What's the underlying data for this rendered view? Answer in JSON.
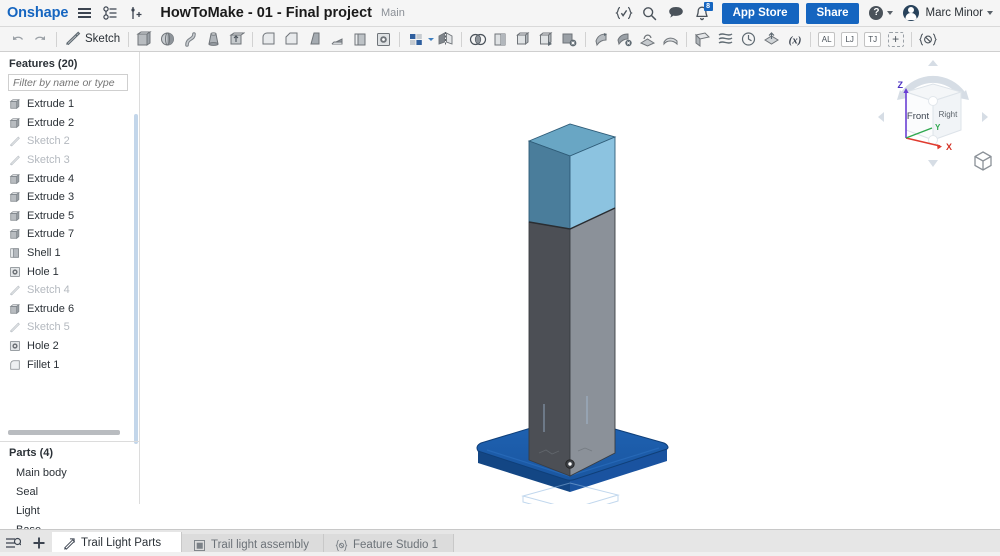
{
  "app": {
    "brand": "Onshape",
    "document_title": "HowToMake - 01 - Final project",
    "branch": "Main"
  },
  "topbar": {
    "icons": [
      {
        "name": "hamburger-menu-icon",
        "glyph": "menu"
      },
      {
        "name": "version-graph-icon",
        "glyph": "branch"
      },
      {
        "name": "insert-version-icon",
        "glyph": "addnode"
      }
    ],
    "right_icons": [
      {
        "name": "featurescript-icon",
        "label": "{v}"
      },
      {
        "name": "search-icon",
        "label": "search"
      },
      {
        "name": "comment-icon",
        "label": "comment"
      },
      {
        "name": "notifications-icon",
        "label": "bell",
        "badge": "8"
      }
    ],
    "app_store_label": "App Store",
    "share_label": "Share",
    "help_label": "?",
    "user_name": "Marc Minor"
  },
  "toolbar": {
    "undo_label": "undo",
    "redo_label": "redo",
    "sketch_label": "Sketch",
    "tools": [
      "extrude-tool",
      "revolve-tool",
      "sweep-tool",
      "loft-tool",
      "thicken-tool",
      "fillet-tool",
      "chamfer-tool",
      "draft-tool",
      "rib-tool",
      "shell-tool",
      "hole-tool",
      "pattern-tool",
      "mirror-tool",
      "boolean-tool",
      "split-tool",
      "transform-tool",
      "move-face-tool",
      "delete-face-tool",
      "replace-face-tool",
      "enclose-tool",
      "plane-tool",
      "sketch-plane-tool",
      "curve-tool",
      "helix-tool",
      "import-derived-tool",
      "variable-tool"
    ],
    "annotation_buttons": [
      "AL",
      "LJ",
      "TJ"
    ],
    "add_custom_label": "+",
    "configuration_label": "{⊘}"
  },
  "features_panel": {
    "title": "Features (20)",
    "filter_placeholder": "Filter by name or type",
    "items": [
      {
        "label": "Extrude 1",
        "icon": "extrude-icon",
        "dim": false
      },
      {
        "label": "Extrude 2",
        "icon": "extrude-icon",
        "dim": false
      },
      {
        "label": "Sketch 2",
        "icon": "sketch-icon",
        "dim": true
      },
      {
        "label": "Sketch 3",
        "icon": "sketch-icon",
        "dim": true
      },
      {
        "label": "Extrude 4",
        "icon": "extrude-icon",
        "dim": false
      },
      {
        "label": "Extrude 3",
        "icon": "extrude-icon",
        "dim": false
      },
      {
        "label": "Extrude 5",
        "icon": "extrude-icon",
        "dim": false
      },
      {
        "label": "Extrude 7",
        "icon": "extrude-icon",
        "dim": false
      },
      {
        "label": "Shell 1",
        "icon": "shell-icon",
        "dim": false
      },
      {
        "label": "Hole 1",
        "icon": "hole-icon",
        "dim": false
      },
      {
        "label": "Sketch 4",
        "icon": "sketch-icon",
        "dim": true
      },
      {
        "label": "Extrude 6",
        "icon": "extrude-icon",
        "dim": false
      },
      {
        "label": "Sketch 5",
        "icon": "sketch-icon",
        "dim": true
      },
      {
        "label": "Hole 2",
        "icon": "hole-icon",
        "dim": false
      },
      {
        "label": "Fillet 1",
        "icon": "fillet-icon",
        "dim": false
      }
    ]
  },
  "parts_panel": {
    "title": "Parts (4)",
    "items": [
      {
        "label": "Main body"
      },
      {
        "label": "Seal"
      },
      {
        "label": "Light"
      },
      {
        "label": "Base"
      }
    ]
  },
  "viewport": {
    "navcube": {
      "front_label": "Front",
      "right_label": "Right",
      "axis_x": "X",
      "axis_y": "Y",
      "axis_z": "Z"
    },
    "model_colors": {
      "light_front": "#4a7d9b",
      "light_right": "#8cc3e0",
      "light_top": "#69a6c4",
      "body_front": "#4c4f55",
      "body_right": "#8b9199",
      "base_top": "#1c5ba8",
      "base_edge": "#134684"
    }
  },
  "tabbar": {
    "tools": [
      {
        "name": "tab-manager-icon"
      },
      {
        "name": "add-tab-icon",
        "label": "+"
      }
    ],
    "tabs": [
      {
        "label": "Trail Light Parts",
        "icon": "part-studio-icon",
        "active": true
      },
      {
        "label": "Trail light assembly",
        "icon": "assembly-icon",
        "active": false
      },
      {
        "label": "Feature Studio 1",
        "icon": "feature-studio-icon",
        "active": false
      }
    ]
  }
}
